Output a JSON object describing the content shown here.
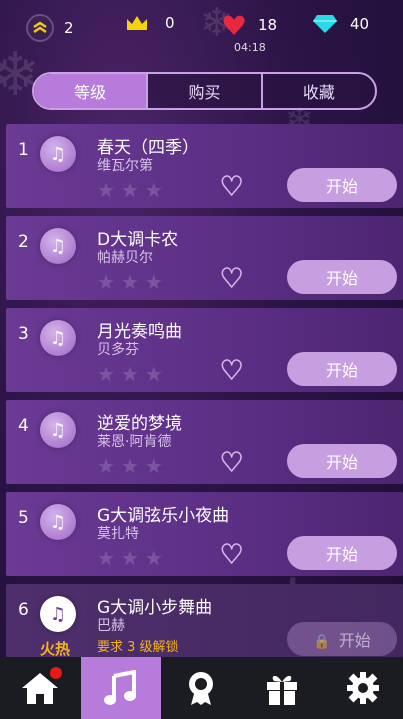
{
  "stats": {
    "rank": "2",
    "crowns": "0",
    "lives": "18",
    "gems": "40",
    "timer": "04:18"
  },
  "tabs": [
    {
      "label": "等级",
      "active": true
    },
    {
      "label": "购买",
      "active": false
    },
    {
      "label": "收藏",
      "active": false
    }
  ],
  "songs": [
    {
      "index": "1",
      "title": "春天（四季）",
      "composer": "维瓦尔第",
      "button": "开始"
    },
    {
      "index": "2",
      "title": "D大调卡农",
      "composer": "帕赫贝尔",
      "button": "开始"
    },
    {
      "index": "3",
      "title": "月光奏鸣曲",
      "composer": "贝多芬",
      "button": "开始"
    },
    {
      "index": "4",
      "title": "逆爱的梦境",
      "composer": "莱恩·阿肯德",
      "button": "开始"
    },
    {
      "index": "5",
      "title": "G大调弦乐小夜曲",
      "composer": "莫扎特",
      "button": "开始"
    },
    {
      "index": "6",
      "title": "G大调小步舞曲",
      "composer": "巴赫",
      "button": "开始",
      "badge": "火热",
      "requirement": "要求 3 级解锁"
    }
  ],
  "icons": {
    "rank": "chevron-rank-icon",
    "crown": "crown-icon",
    "heart": "heart-icon",
    "gem": "diamond-icon",
    "note": "music-note-icon",
    "favorite": "heart-outline-icon",
    "lock": "lock-icon",
    "nav": [
      "home-icon",
      "music-icon",
      "badge-icon",
      "gift-icon",
      "gear-icon"
    ]
  },
  "colors": {
    "accent": "#b77bdc",
    "crown": "#f5d30a",
    "heart": "#e8283c",
    "gem": "#29d9e8",
    "hot": "#f7b21a"
  }
}
